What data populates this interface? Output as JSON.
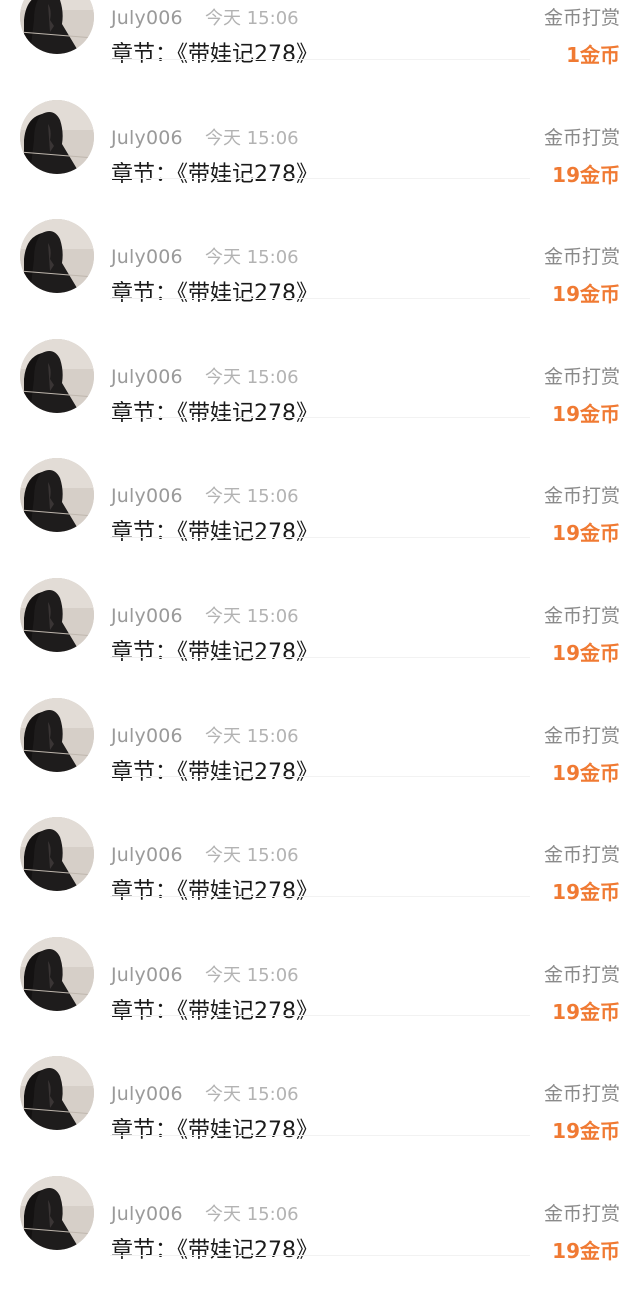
{
  "rewards": [
    {
      "username": "July006",
      "time": "今天 15:06",
      "chapter": "章节：《带娃记278》",
      "type": "金币打赏",
      "amount": "1金币"
    },
    {
      "username": "July006",
      "time": "今天 15:06",
      "chapter": "章节：《带娃记278》",
      "type": "金币打赏",
      "amount": "19金币"
    },
    {
      "username": "July006",
      "time": "今天 15:06",
      "chapter": "章节：《带娃记278》",
      "type": "金币打赏",
      "amount": "19金币"
    },
    {
      "username": "July006",
      "time": "今天 15:06",
      "chapter": "章节：《带娃记278》",
      "type": "金币打赏",
      "amount": "19金币"
    },
    {
      "username": "July006",
      "time": "今天 15:06",
      "chapter": "章节：《带娃记278》",
      "type": "金币打赏",
      "amount": "19金币"
    },
    {
      "username": "July006",
      "time": "今天 15:06",
      "chapter": "章节：《带娃记278》",
      "type": "金币打赏",
      "amount": "19金币"
    },
    {
      "username": "July006",
      "time": "今天 15:06",
      "chapter": "章节：《带娃记278》",
      "type": "金币打赏",
      "amount": "19金币"
    },
    {
      "username": "July006",
      "time": "今天 15:06",
      "chapter": "章节：《带娃记278》",
      "type": "金币打赏",
      "amount": "19金币"
    },
    {
      "username": "July006",
      "time": "今天 15:06",
      "chapter": "章节：《带娃记278》",
      "type": "金币打赏",
      "amount": "19金币"
    },
    {
      "username": "July006",
      "time": "今天 15:06",
      "chapter": "章节：《带娃记278》",
      "type": "金币打赏",
      "amount": "19金币"
    },
    {
      "username": "July006",
      "time": "今天 15:06",
      "chapter": "章节：《带娃记278》",
      "type": "金币打赏",
      "amount": "19金币"
    }
  ],
  "colors": {
    "amount": "#f07a33",
    "username": "#9a9a9a",
    "chapter": "#1a1a1a"
  }
}
